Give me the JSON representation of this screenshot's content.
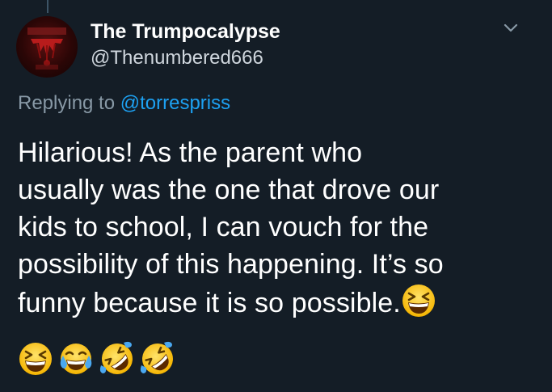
{
  "author": {
    "display_name": "The Trumpocalypse",
    "handle": "@Thenumbered666",
    "avatar_icon": "red-horror-logo-avatar"
  },
  "reply": {
    "prefix": "Replying to ",
    "mention": "@torrespriss"
  },
  "tweet": {
    "lines": [
      "Hilarious! As the parent who",
      "usually was the one that drove our",
      "kids to school, I can vouch for the",
      "possibility of this happening. It’s so",
      "funny because it is so possible."
    ],
    "emojis": [
      "grinning-squinting-face",
      "grinning-squinting-face",
      "face-with-tears-of-joy",
      "rolling-on-floor-laughing",
      "rolling-on-floor-laughing"
    ]
  },
  "menu": {
    "icon": "chevron-down-icon"
  },
  "colors": {
    "background": "#141d26",
    "link": "#1da1f2",
    "muted": "#8899a6",
    "text": "#ffffff"
  }
}
